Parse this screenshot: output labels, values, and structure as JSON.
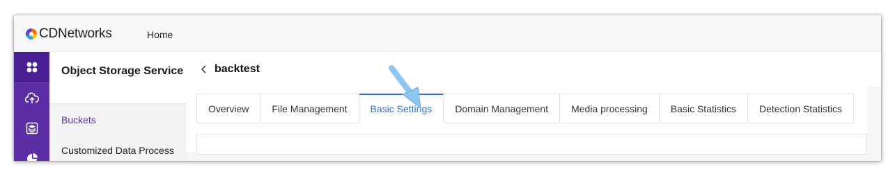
{
  "brand": {
    "logo_text": "CDNetworks"
  },
  "top_nav": {
    "home": "Home"
  },
  "rail": {
    "items": [
      {
        "icon": "grid-icon"
      },
      {
        "icon": "cloud-upload-icon"
      },
      {
        "icon": "layers-icon"
      },
      {
        "icon": "pie-chart-icon"
      }
    ]
  },
  "submenu": {
    "title": "Object Storage Service",
    "items": [
      {
        "label": "Buckets",
        "active": true
      },
      {
        "label": "Customized Data Process",
        "active": false
      }
    ]
  },
  "page": {
    "title": "backtest"
  },
  "tabs": [
    {
      "label": "Overview",
      "active": false
    },
    {
      "label": "File Management",
      "active": false
    },
    {
      "label": "Basic Settings",
      "active": true
    },
    {
      "label": "Domain Management",
      "active": false
    },
    {
      "label": "Media processing",
      "active": false
    },
    {
      "label": "Basic Statistics",
      "active": false
    },
    {
      "label": "Detection Statistics",
      "active": false
    }
  ],
  "colors": {
    "rail_bg": "#5b2ea6",
    "accent_purple": "#5b2ea6",
    "active_tab_blue": "#2f6fd6",
    "pointer_arrow": "#8ec6f2"
  }
}
